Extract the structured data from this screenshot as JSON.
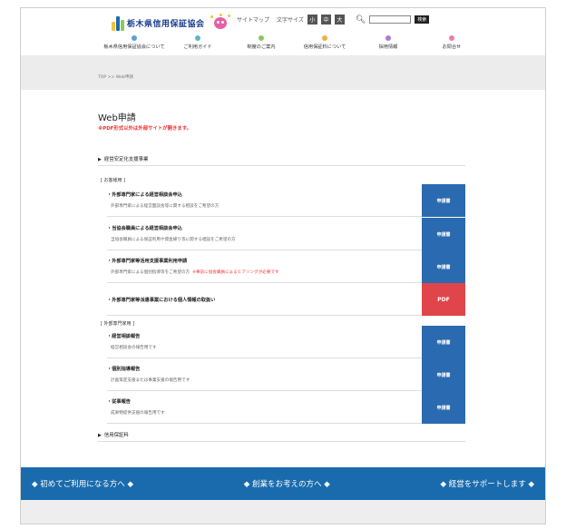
{
  "header": {
    "logo_text": "栃木県信用保証協会",
    "sitemap": "サイトマップ",
    "font_size_label": "文字サイズ",
    "font_sizes": [
      "小",
      "中",
      "大"
    ],
    "search_button": "検索"
  },
  "nav": [
    {
      "label": "栃木県信用保証協会について",
      "color": "#5aa0d8"
    },
    {
      "label": "ご利用ガイド",
      "color": "#5ab8c8"
    },
    {
      "label": "制度のご案内",
      "color": "#8cc85a"
    },
    {
      "label": "信用保証料について",
      "color": "#f0b040"
    },
    {
      "label": "採用情報",
      "color": "#b07ad0"
    },
    {
      "label": "お問合せ",
      "color": "#f07aa8"
    }
  ],
  "breadcrumb": "TOP >> Web申請",
  "page_title": "Web申請",
  "warning": "※PDF形式以外は外部サイトが開きます。",
  "sections": {
    "s1": "経営安定化支援事業",
    "s2": "信用保証料"
  },
  "groups": {
    "g1": "[ お客様用 ]",
    "g2": "[ 外部専門家用 ]"
  },
  "rows": [
    {
      "title": "・外部専門家による経営相談会申込",
      "desc": "外部専門家による経営面談会等に関する相談をご希望の方",
      "note": "",
      "button": "申請書"
    },
    {
      "title": "・当協会職員による経営相談会申込",
      "desc": "当協会職員による保証利用や資金繰り等に関する相談をご希望の方",
      "note": "",
      "button": "申請書"
    },
    {
      "title": "・外部専門家等活用支援事業利用申請",
      "desc": "外部専門家による個別指導等をご希望の方",
      "note": "※事前に協会職員によるヒアリングが必要です",
      "button": "申請書"
    },
    {
      "title": "・外部専門家等派遣事業における個人情報の取扱い",
      "desc": "",
      "note": "",
      "button": "PDF"
    },
    {
      "title": "・経営相談報告",
      "desc": "経営相談会の報告用です",
      "note": "",
      "button": "申請書"
    },
    {
      "title": "・個別指導報告",
      "desc": "計画策定支援または事業支援の報告用です",
      "note": "",
      "button": "申請書"
    },
    {
      "title": "・従事報告",
      "desc": "成果物提供支援の報告用です",
      "note": "",
      "button": "申請書"
    }
  ],
  "footer_links": [
    "◆ 初めてご利用になる方へ ◆",
    "◆ 創業をお考えの方へ ◆",
    "◆ 経営をサポートします ◆"
  ],
  "colors": {
    "primary_button": "#2a6ab0",
    "pdf_button": "#e0454b",
    "footer_band": "#1a6bad",
    "warning": "#e33333"
  }
}
